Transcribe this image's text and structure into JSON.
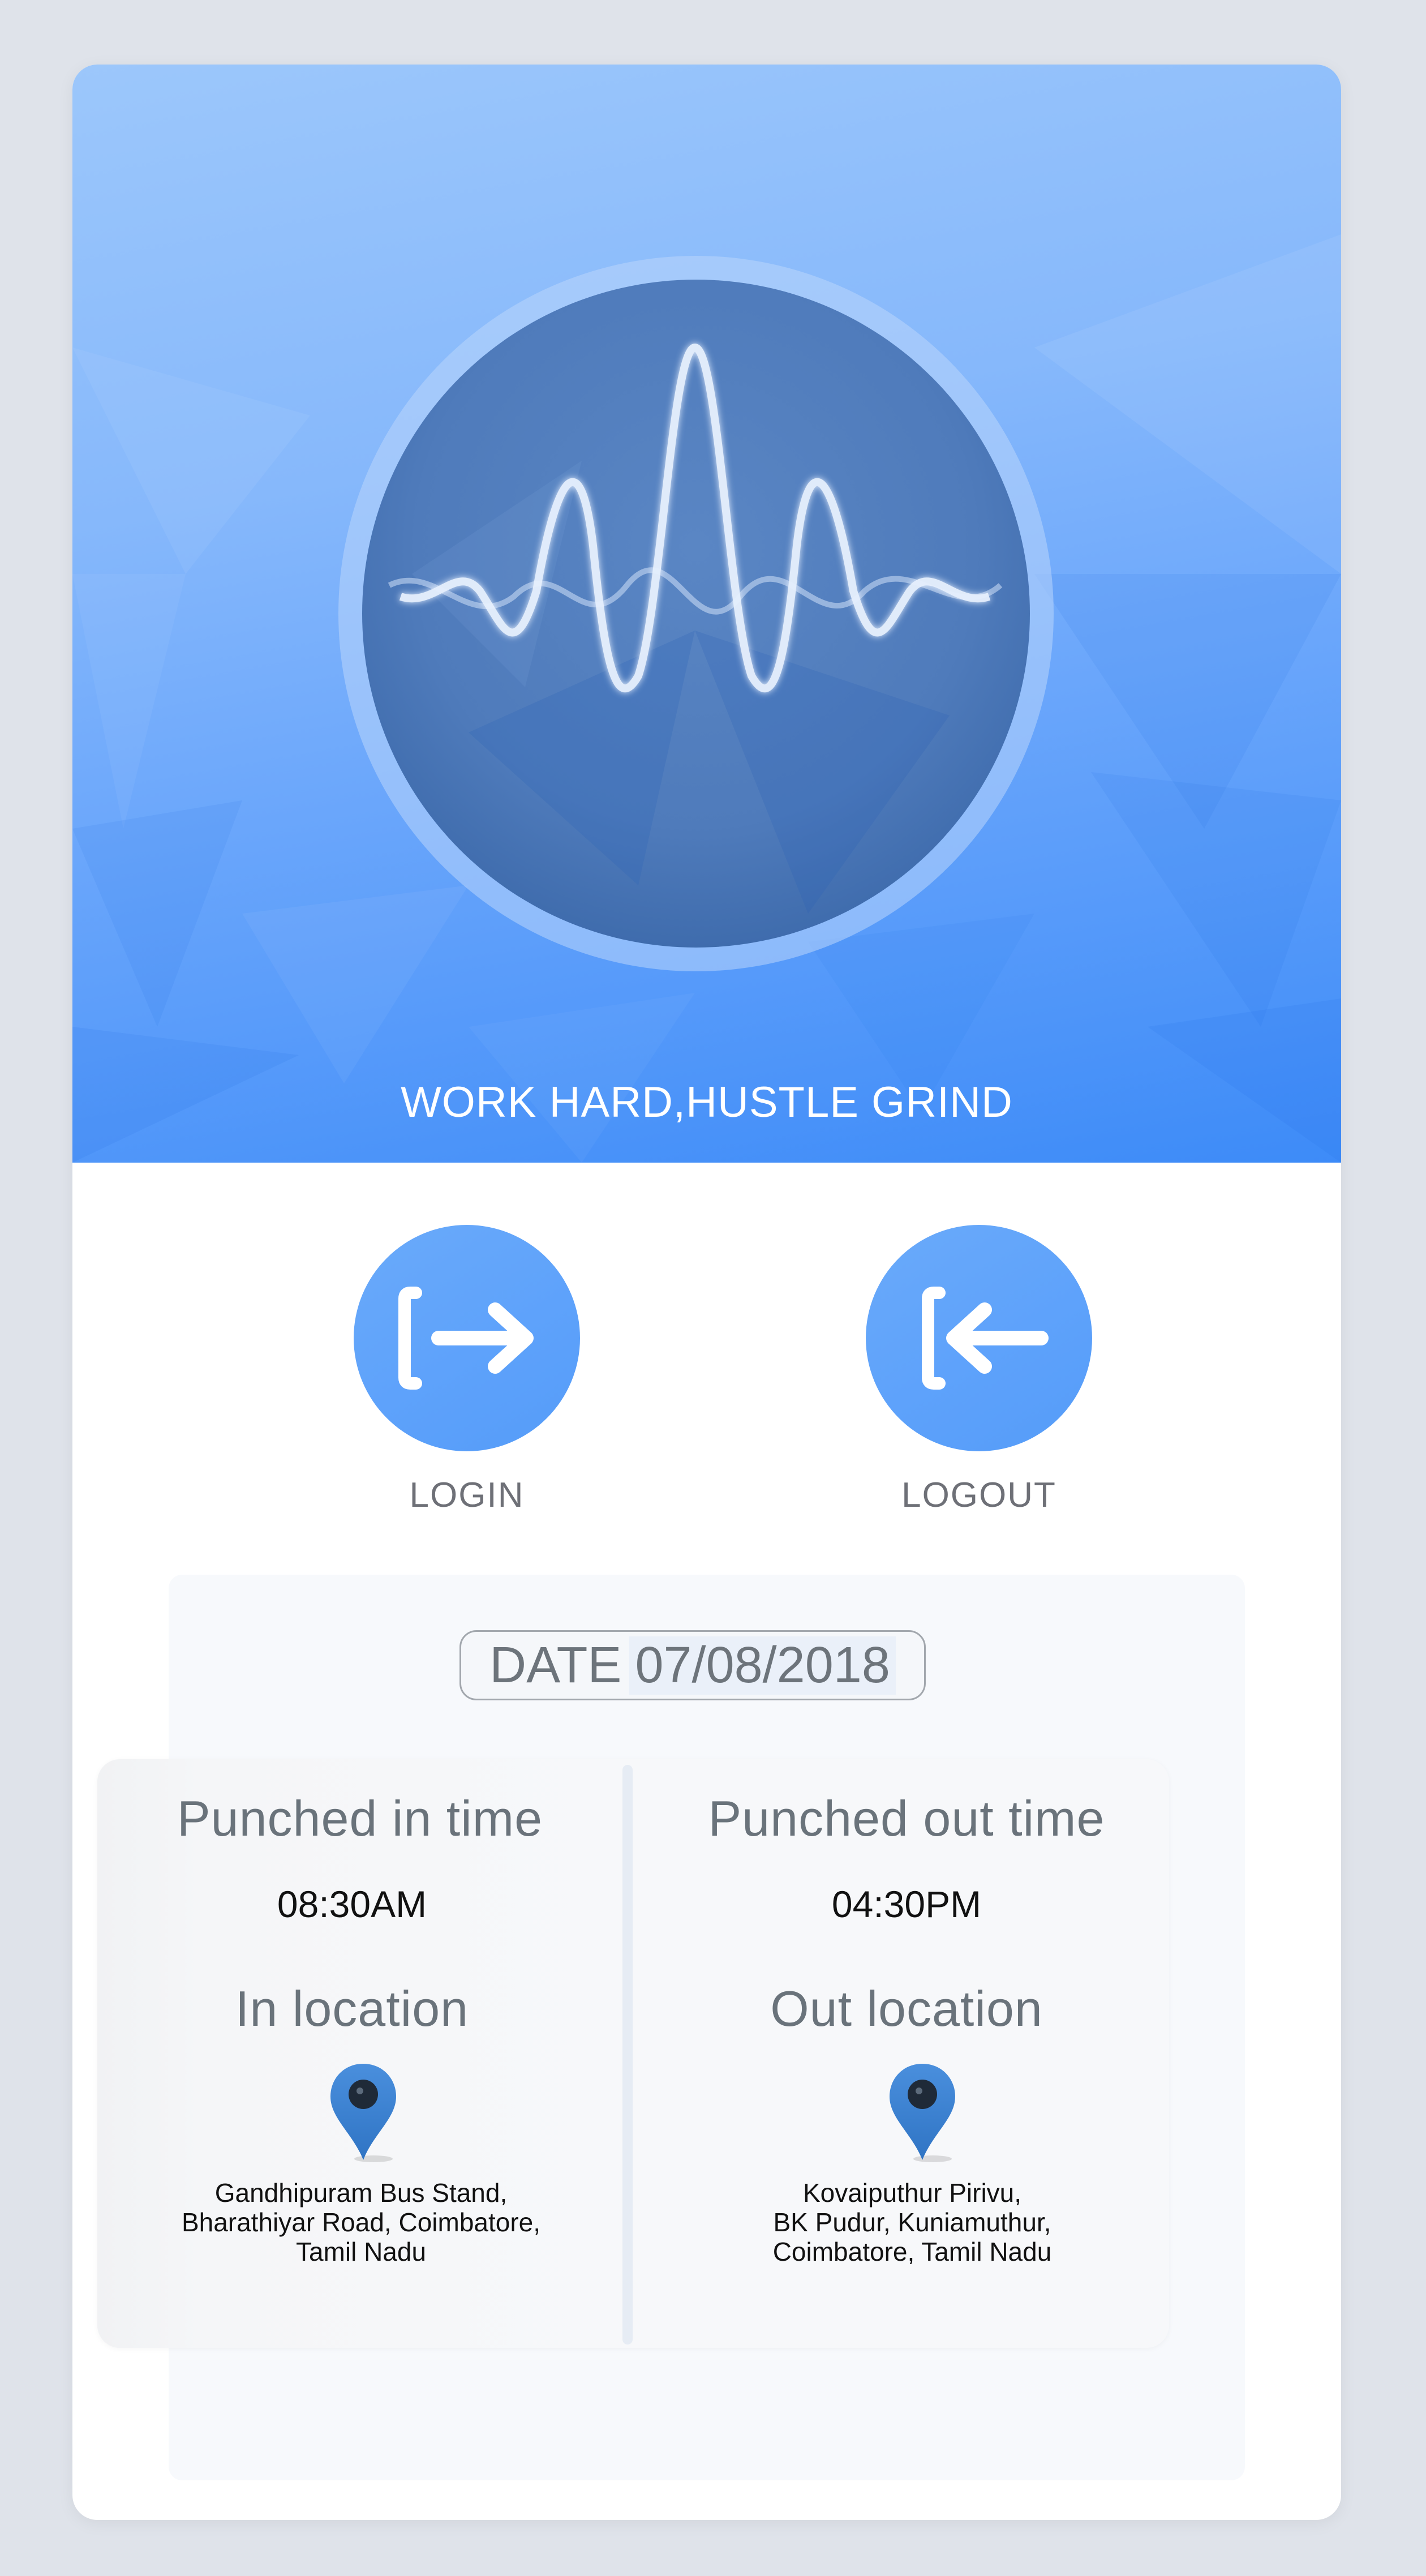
{
  "hero": {
    "title": "WORK HARD,HUSTLE GRIND",
    "graphic": "sound-wave-icon"
  },
  "actions": {
    "login": {
      "label": "LOGIN",
      "icon": "login-arrow-icon"
    },
    "logout": {
      "label": "LOGOUT",
      "icon": "logout-arrow-icon"
    }
  },
  "date": {
    "label": "DATE",
    "value": "07/08/2018"
  },
  "punch": {
    "in": {
      "heading": "Punched in time",
      "time": "08:30AM",
      "location_heading": "In location",
      "icon": "map-pin-icon",
      "address_lines": [
        "Gandhipuram Bus Stand,",
        "Bharathiyar Road, Coimbatore,",
        "Tamil Nadu"
      ]
    },
    "out": {
      "heading": "Punched out time",
      "time": "04:30PM",
      "location_heading": "Out location",
      "icon": "map-pin-icon",
      "address_lines": [
        "Kovaiputhur Pirivu,",
        "BK Pudur, Kuniamuthur,",
        "Coimbatore, Tamil Nadu"
      ]
    }
  },
  "colors": {
    "accent": "#62a6fb",
    "hero_top": "#9cc7fb",
    "hero_bottom": "#3d8bf8",
    "pin": "#3a7fd0"
  }
}
